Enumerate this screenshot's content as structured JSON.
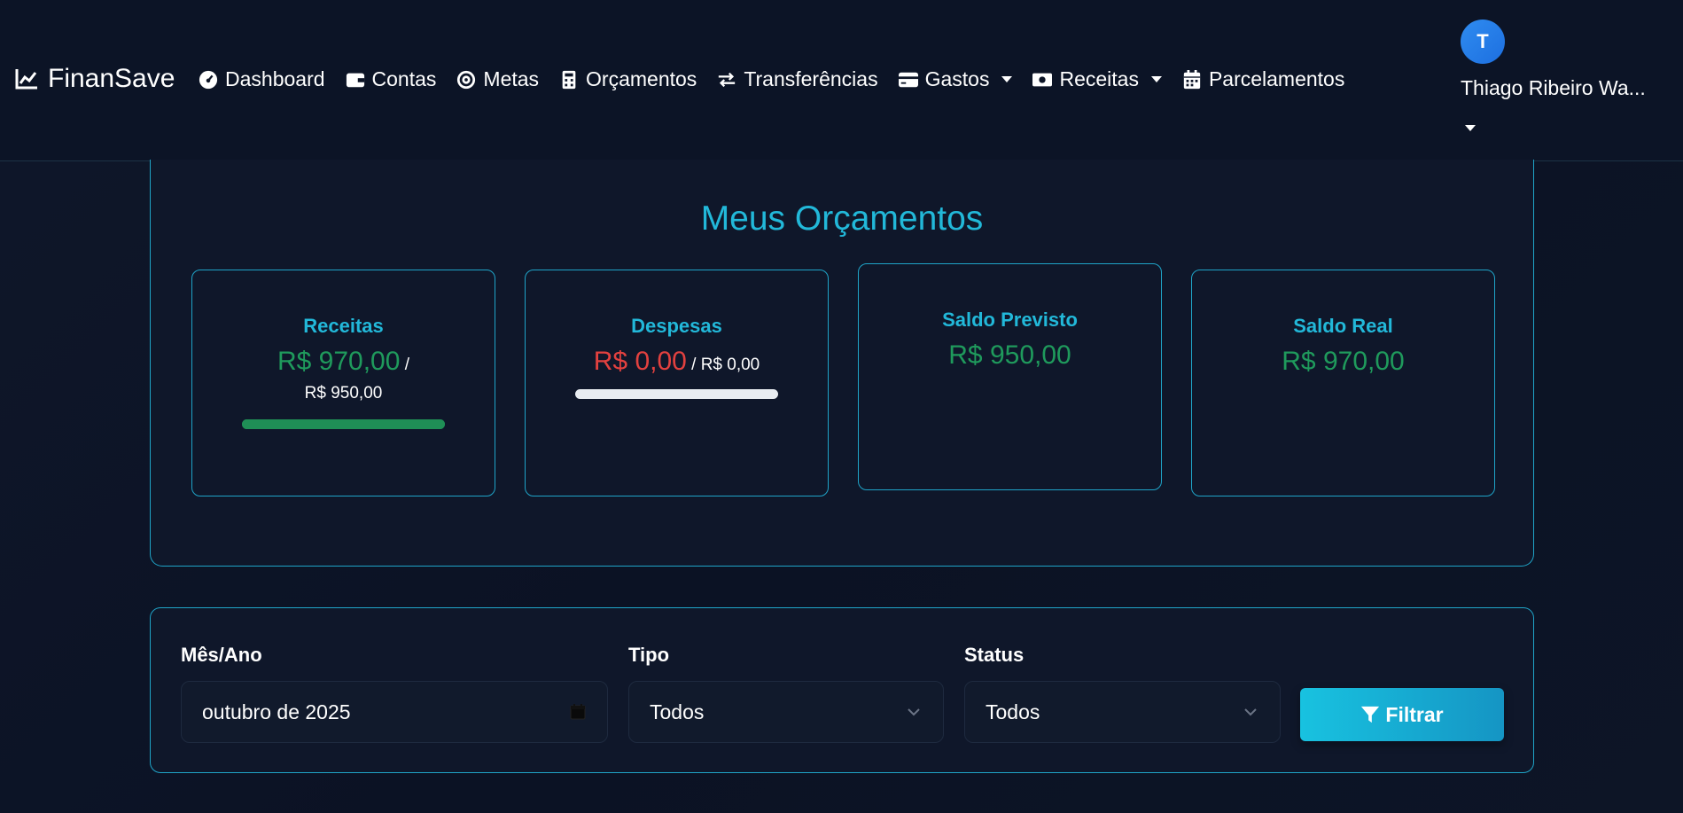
{
  "navbar": {
    "brand": "FinanSave",
    "items": [
      {
        "label": "Dashboard",
        "icon": "gauge-icon"
      },
      {
        "label": "Contas",
        "icon": "wallet-icon"
      },
      {
        "label": "Metas",
        "icon": "target-icon"
      },
      {
        "label": "Orçamentos",
        "icon": "calculator-icon"
      },
      {
        "label": "Transferências",
        "icon": "exchange-icon"
      },
      {
        "label": "Gastos",
        "icon": "credit-card-icon",
        "dropdown": true
      },
      {
        "label": "Receitas",
        "icon": "money-bill-icon",
        "dropdown": true
      },
      {
        "label": "Parcelamentos",
        "icon": "calendar-icon"
      }
    ],
    "user": {
      "initial": "T",
      "name": "Thiago Ribeiro Wa..."
    }
  },
  "budget": {
    "title": "Meus Orçamentos",
    "cards": [
      {
        "title": "Receitas",
        "amount": "R$ 970,00",
        "separator": "/",
        "target": "R$ 950,00",
        "progress": 1.0,
        "progress_color": "#1f8f56"
      },
      {
        "title": "Despesas",
        "amount": "R$ 0,00",
        "separator": "/",
        "target": "R$ 0,00",
        "progress": 0.0
      },
      {
        "title": "Saldo Previsto",
        "amount": "R$ 950,00"
      },
      {
        "title": "Saldo Real",
        "amount": "R$ 970,00"
      }
    ]
  },
  "filters": {
    "month_label": "Mês/Ano",
    "month_value": "outubro de 2025",
    "type_label": "Tipo",
    "type_value": "Todos",
    "status_label": "Status",
    "status_value": "Todos",
    "button_label": "Filtrar"
  },
  "colors": {
    "accent": "#22b8d9",
    "positive": "#1f9a5c",
    "negative": "#e2413f"
  }
}
